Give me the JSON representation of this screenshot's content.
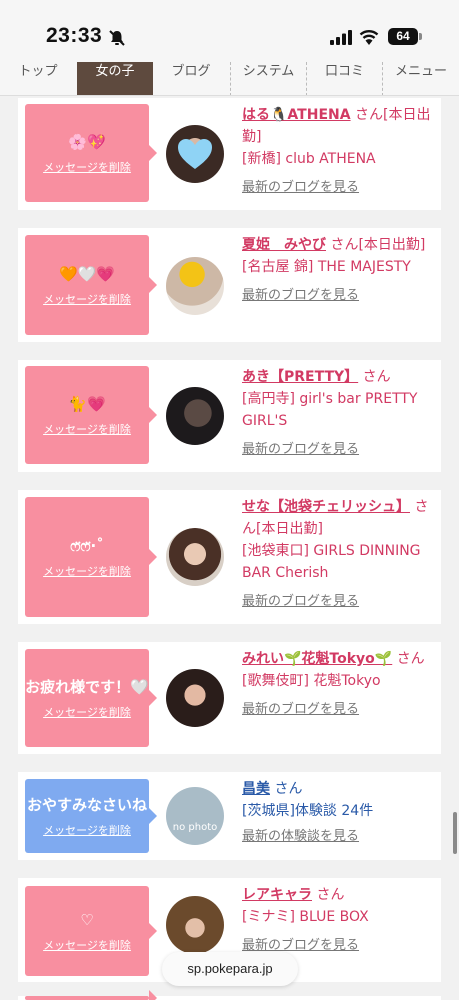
{
  "status": {
    "time": "23:33",
    "battery": "64"
  },
  "nav": {
    "tabs": [
      "トップ",
      "女の子",
      "ブログ",
      "システム",
      "口コミ",
      "メニュー"
    ],
    "active": "女の子"
  },
  "delete_label": "メッセージを削除",
  "cards": [
    {
      "message": "🌸💖",
      "name": "はる🐧ATHENA",
      "san": "さん[本日出勤]",
      "shop": "[新橋] club ATHENA",
      "link": "最新のブログを見る",
      "color": "pink"
    },
    {
      "message": "🧡🤍💗",
      "name": "夏姫　みやび",
      "san": "さん[本日出勤]",
      "shop": "[名古屋 錦] THE MAJESTY",
      "link": "最新のブログを見る",
      "color": "pink"
    },
    {
      "message": "🐈💗",
      "name": "あき【PRETTY】",
      "san": "さん",
      "shop": "[高円寺] girl's bar PRETTY GIRL'S",
      "link": "最新のブログを見る",
      "color": "pink"
    },
    {
      "message": "ෆ̈ෆ̈·˚",
      "name": "せな【池袋チェリッシュ】",
      "san": "さん[本日出勤]",
      "shop": "[池袋東口] GIRLS DINNING BAR Cherish",
      "link": "最新のブログを見る",
      "color": "pink"
    },
    {
      "message": "お疲れ様です！🤍",
      "name": "みれい🌱花魁Tokyo🌱",
      "san": "さん",
      "shop": "[歌舞伎町] 花魁Tokyo",
      "link": "最新のブログを見る",
      "color": "pink"
    },
    {
      "message": "おやすみなさいね",
      "name": "昌美",
      "san": "さん",
      "shop": "[茨城県]体験談 24件",
      "link": "最新の体験談を見る",
      "color": "blue",
      "avatar_text": "no photo"
    },
    {
      "message": "♡",
      "name": "レアキャラ",
      "san": "さん",
      "shop": "[ミナミ] BLUE BOX",
      "link": "最新のブログを見る",
      "color": "pink"
    }
  ],
  "url": "sp.pokepara.jp",
  "colors": {
    "accent": "#d23a63",
    "pink_box": "#f88fa0",
    "blue_box": "#7faaf0",
    "nav_active": "#5e4a3e"
  }
}
